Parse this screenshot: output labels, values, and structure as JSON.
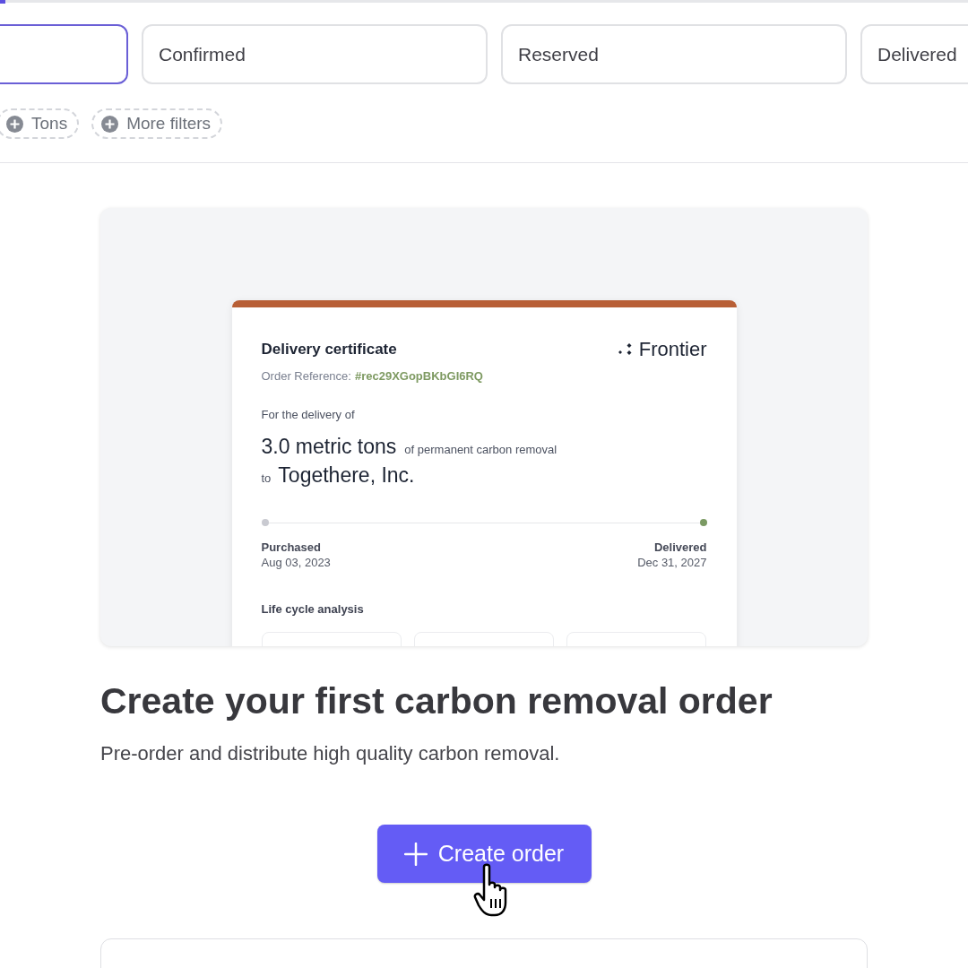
{
  "status_tabs": [
    {
      "selected": true
    },
    {
      "label": "Confirmed",
      "selected": false
    },
    {
      "label": "Reserved",
      "selected": false
    },
    {
      "label": "Delivered",
      "selected": false
    }
  ],
  "filter_chips": [
    {
      "label": "Tons"
    },
    {
      "label": "More filters"
    }
  ],
  "certificate": {
    "title": "Delivery certificate",
    "brand": "Frontier",
    "reference_label": "Order Reference:",
    "reference_value": "#rec29XGopBKbGI6RQ",
    "intro": "For the delivery of",
    "amount": "3.0 metric tons",
    "amount_note": "of permanent carbon removal",
    "to_word": "to",
    "recipient": "Togethere, Inc.",
    "milestones": [
      {
        "label": "Purchased",
        "date": "Aug 03, 2023",
        "color": "#c9cad1"
      },
      {
        "label": "Delivered",
        "date": "Dec 31, 2027",
        "color": "#7b9a63"
      }
    ],
    "section_title": "Life cycle analysis"
  },
  "heading": "Create your first carbon removal order",
  "subtitle": "Pre-order and distribute high quality carbon removal.",
  "primary_button": {
    "label": "Create order"
  }
}
